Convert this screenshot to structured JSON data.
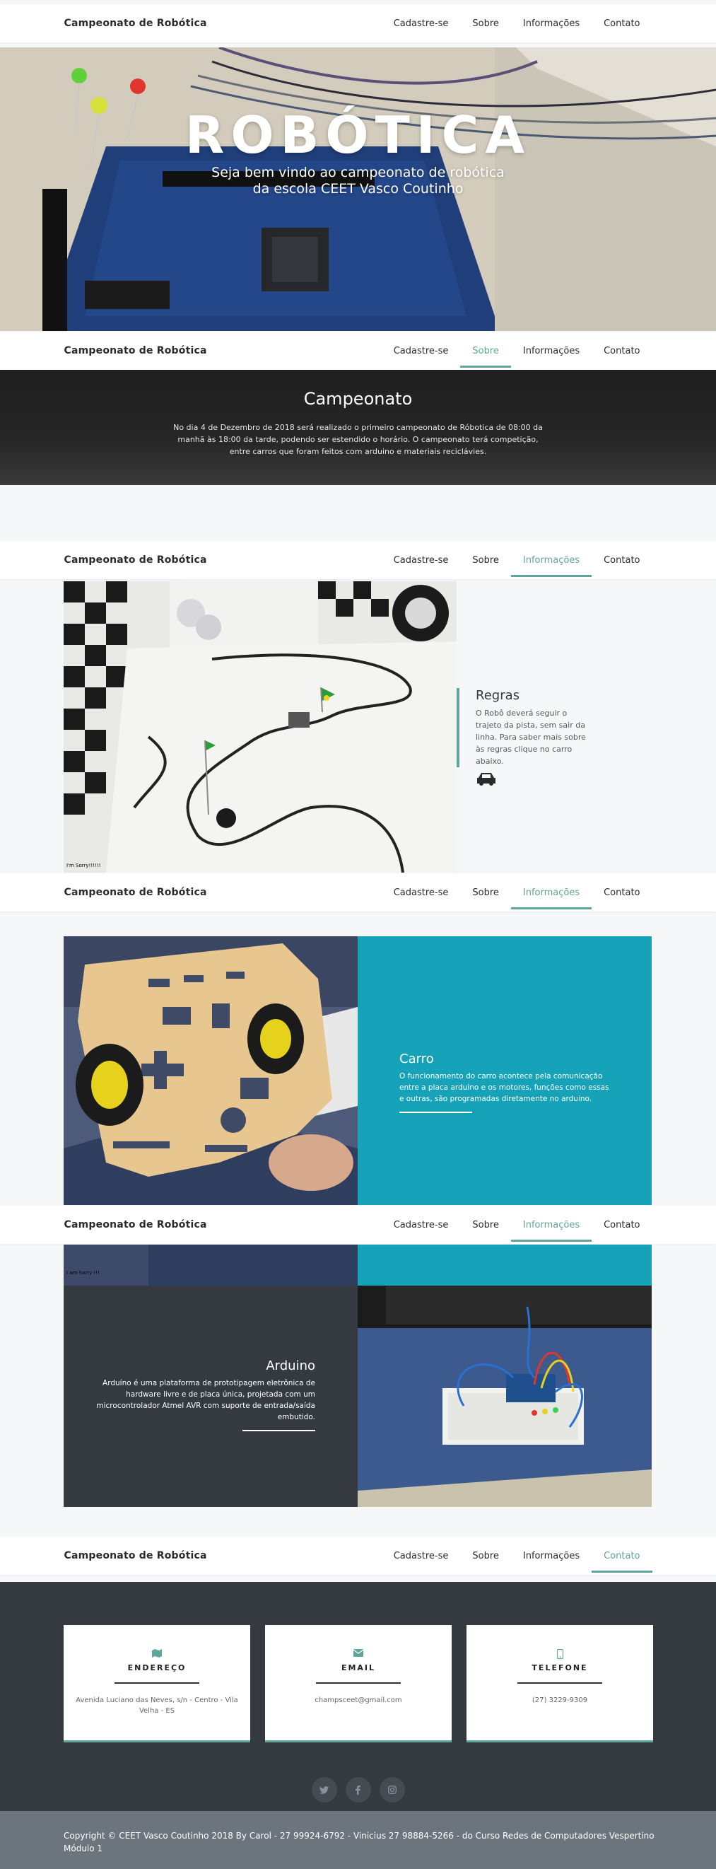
{
  "brand": "Campeonato de Robótica",
  "nav": {
    "signup": "Cadastre-se",
    "about": "Sobre",
    "info": "Informações",
    "contact": "Contato"
  },
  "hero": {
    "title": "ROBÓTICA",
    "subtitle_line1": "Seja bem vindo ao campeonato de robótica",
    "subtitle_line2": "da escola CEET Vasco Coutinho"
  },
  "about": {
    "title": "Campeonato",
    "text": "No dia 4 de Dezembro de 2018 será realizado o primeiro campeonato de Róbotica de 08:00 da manhã às 18:00 da tarde, podendo ser estendido o horário. O campeonato terá competição, entre carros que foram feitos com arduino e materiais reciclávies."
  },
  "rules": {
    "title": "Regras",
    "text": "O Robô deverá seguir o trajeto da pista, sem sair da linha. Para saber mais sobre às regras clique no carro abaixo.",
    "photo_caption": "I'm Sorry!!!!!!"
  },
  "carro": {
    "title": "Carro",
    "text": "O funcionamento do carro acontece pela comunicação entre a placa arduino e os motores, funções como essas e outras, são programadas diretamente no arduino."
  },
  "arduino": {
    "title": "Arduino",
    "text": "Arduíno é uma plataforma de prototipagem eletrônica de hardware livre e de placa única, projetada com um microcontrolador Atmel AVR com suporte de entrada/saída embutido.",
    "photo_caption": "I am Sorry !!!"
  },
  "contact": {
    "address_title": "ENDEREÇO",
    "address": "Avenida Luciano das Neves, s/n - Centro - Vila Velha - ES",
    "email_title": "EMAIL",
    "email": "champsceet@gmail.com",
    "phone_title": "TELEFONE",
    "phone": "(27) 3229-9309"
  },
  "colors": {
    "accent": "#5fa69a",
    "teal": "#16a2b8",
    "dark": "#343a40",
    "footer": "#6c757d"
  },
  "footer": {
    "text": "Copyright © CEET Vasco Coutinho 2018 By Carol - 27 99924-6792 - Vinicius 27 98884-5266 - do Curso Redes de Computadores Vespertino Módulo 1"
  }
}
